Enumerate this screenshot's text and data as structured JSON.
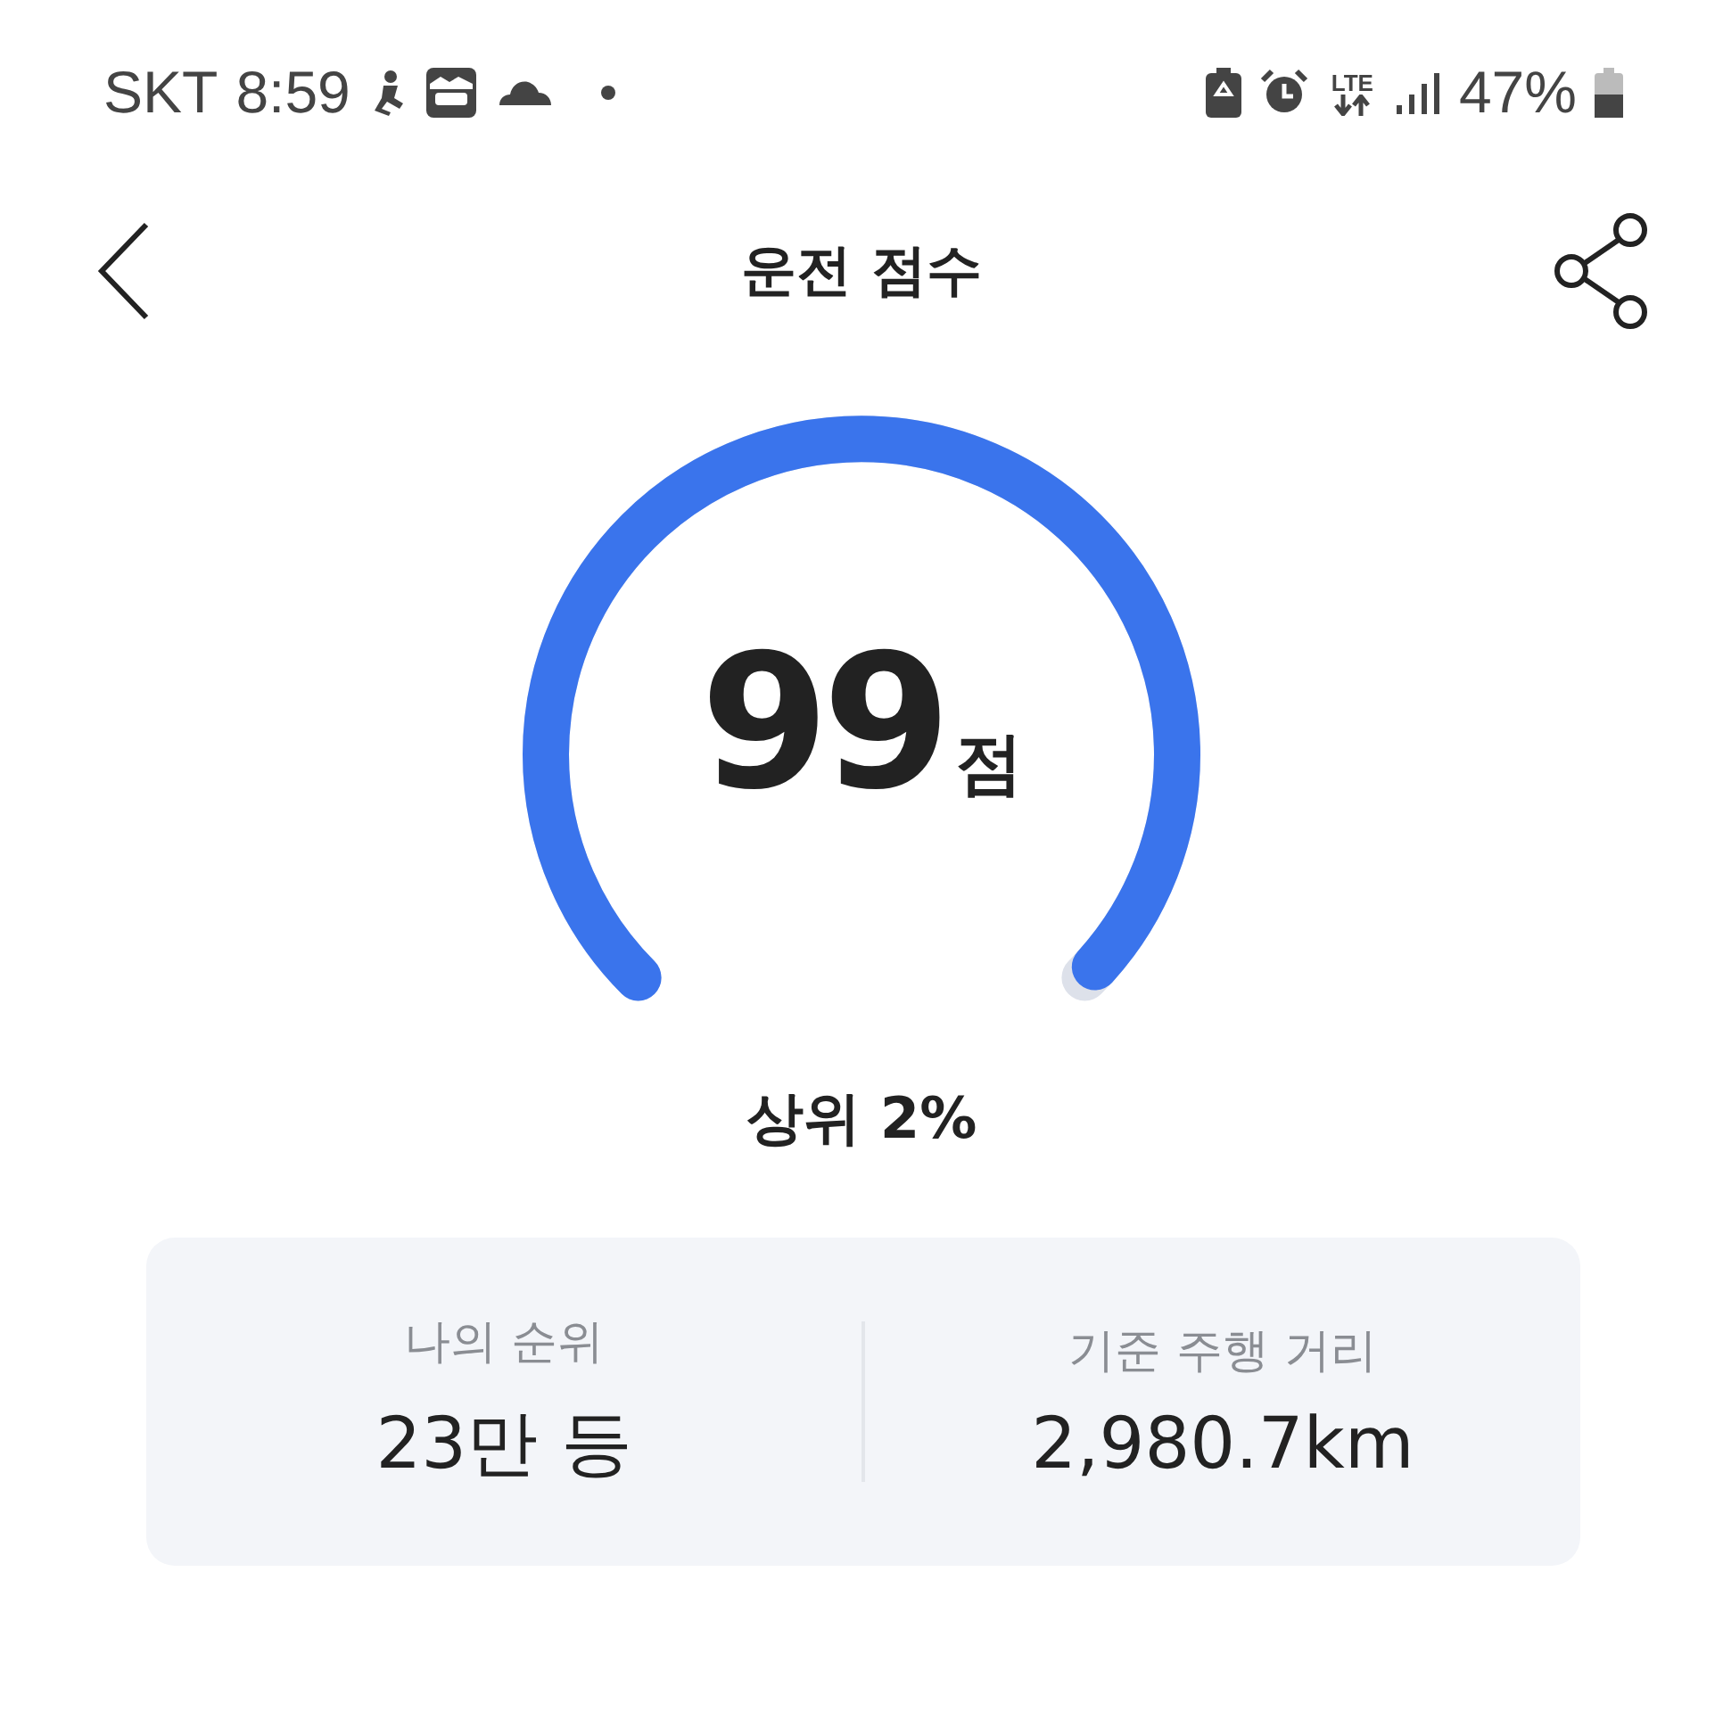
{
  "status_bar": {
    "carrier": "SKT",
    "time": "8:59",
    "network": "LTE",
    "battery_percent": "47%"
  },
  "header": {
    "title": "운전 점수"
  },
  "score": {
    "value": "99",
    "unit": "점",
    "rank_text": "상위 2%"
  },
  "stats": [
    {
      "label": "나의 순위",
      "value": "23만 등"
    },
    {
      "label": "기준 주행 거리",
      "value": "2,980.7km"
    }
  ]
}
